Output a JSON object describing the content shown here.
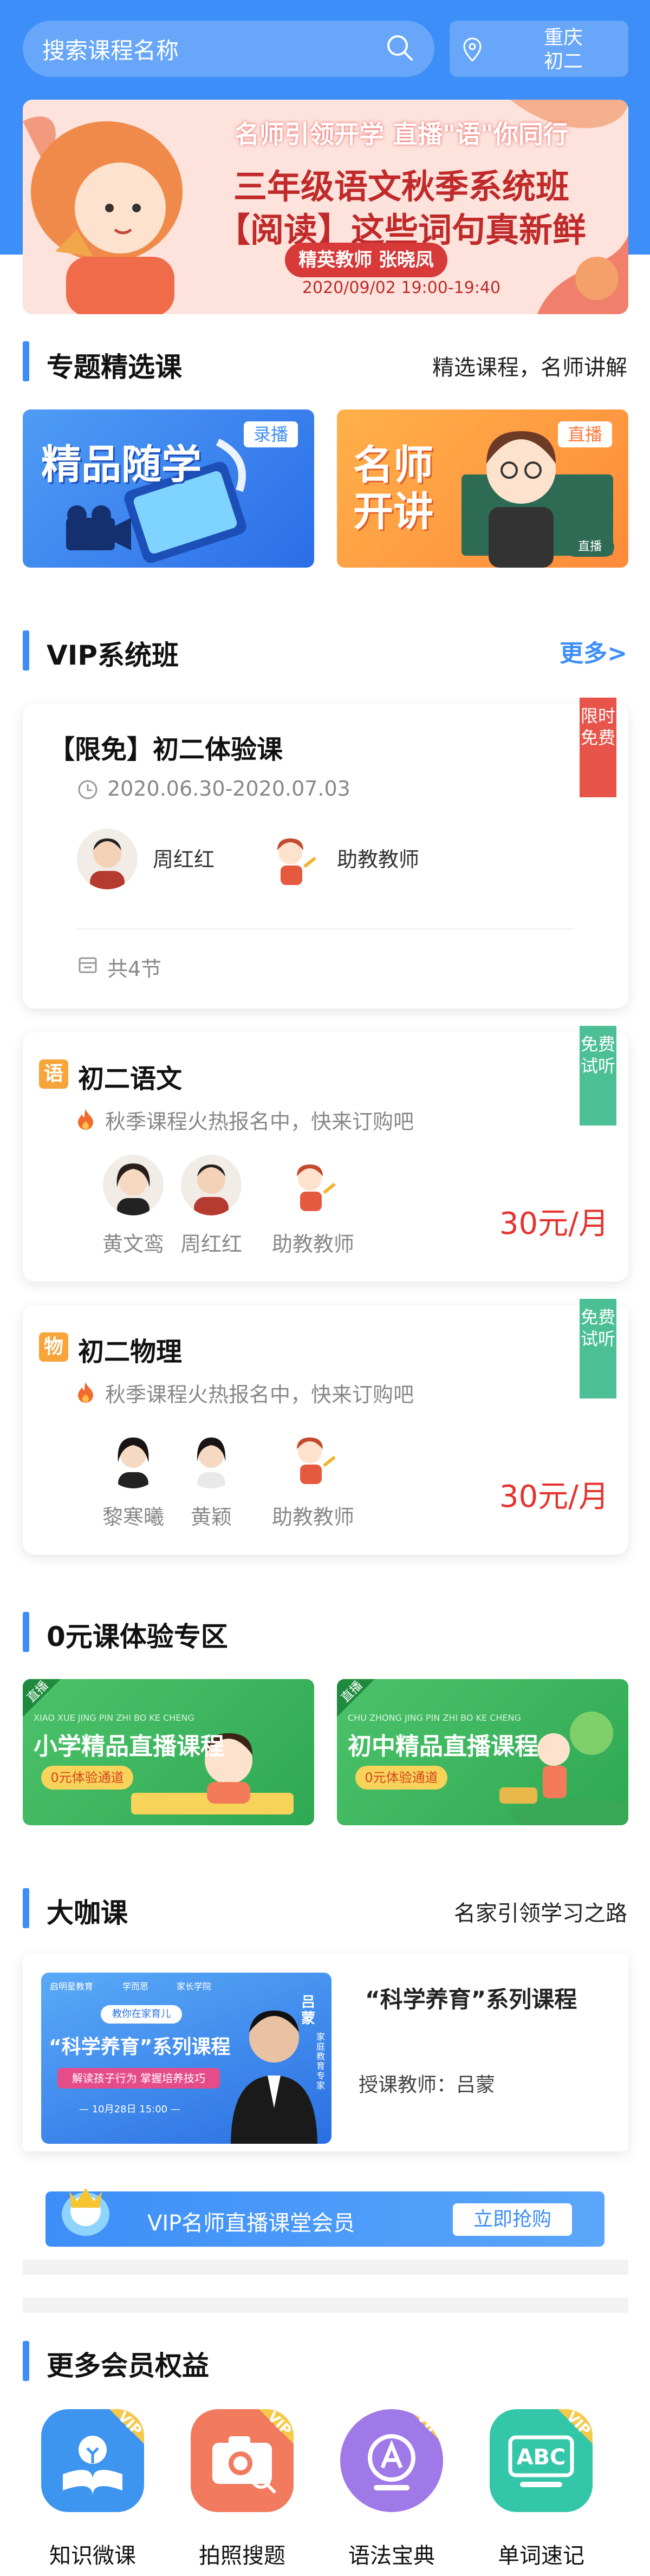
{
  "header": {
    "search_placeholder": "搜索课程名称",
    "location_city": "重庆",
    "location_grade": "初二"
  },
  "banner": {
    "line1": "名师引领开学 直播\"语\"你同行",
    "line2": "三年级语文秋季系统班",
    "line3": "【阅读】这些词句真新鲜",
    "tag": "精英教师 张晓凤",
    "date": "2020/09/02 19:00-19:40"
  },
  "featured": {
    "title": "专题精选课",
    "subtitle": "精选课程，名师讲解",
    "cards": [
      {
        "title": "精品随学",
        "badge": "录播"
      },
      {
        "title": "名师开讲",
        "badge": "直播",
        "mini_tag": "直播"
      }
    ]
  },
  "vip": {
    "title": "VIP系统班",
    "more": "更多>",
    "trial_course": {
      "ribbon": "限时免费",
      "title": "【限免】初二体验课",
      "date": "2020.06.30-2020.07.03",
      "teachers": [
        "周红红",
        "助教教师"
      ],
      "lessons": "共4节"
    },
    "courses": [
      {
        "subject_badge": "语",
        "title": "初二语文",
        "ribbon": "免费试听",
        "desc": "秋季课程火热报名中，快来订购吧",
        "teachers": [
          "黄文鸾",
          "周红红",
          "助教教师"
        ],
        "price": "30元/月"
      },
      {
        "subject_badge": "物",
        "title": "初二物理",
        "ribbon": "免费试听",
        "desc": "秋季课程火热报名中，快来订购吧",
        "teachers": [
          "黎寒曦",
          "黄颖",
          "助教教师"
        ],
        "price": "30元/月"
      }
    ]
  },
  "zero": {
    "title": "0元课体验专区",
    "cards": [
      {
        "corner": "直播",
        "pinyin": "XIAO XUE JING PIN ZHI BO KE CHENG",
        "title": "小学精品直播课程",
        "button": "0元体验通道"
      },
      {
        "corner": "直播",
        "pinyin": "CHU ZHONG JING PIN ZHI BO KE CHENG",
        "title": "初中精品直播课程",
        "button": "0元体验通道"
      }
    ]
  },
  "master": {
    "title": "大咖课",
    "subtitle": "名家引领学习之路",
    "course_title": "“科学养育”系列课程",
    "teacher_line": "授课教师：吕蒙",
    "poster": {
      "brand1": "启明星教育",
      "brand2": "学而思",
      "brand3": "家长学院",
      "top": "教你在家育儿",
      "main": "“科学养育”系列课程",
      "sub": "解读孩子行为 掌握培养技巧",
      "date": "— 10月28日 15:00 —",
      "name": "吕蒙",
      "role": "家庭教育专家"
    }
  },
  "vip_bar": {
    "text": "VIP名师直播课堂会员",
    "button": "立即抢购"
  },
  "benefits": {
    "title": "更多会员权益",
    "items": [
      {
        "label": "知识微课",
        "icon": "lightbulb-book-icon",
        "color": "#3d95f0"
      },
      {
        "label": "拍照搜题",
        "icon": "camera-search-icon",
        "color": "#f27a5e"
      },
      {
        "label": "语法宝典",
        "icon": "letter-a-icon",
        "color": "#a079e8"
      },
      {
        "label": "单词速记",
        "icon": "abc-icon",
        "color": "#33c6a8"
      }
    ],
    "vip_badge": "VIP"
  },
  "colors": {
    "primary": "#3d8ef8",
    "price": "#e5342f",
    "free_ribbon": "#e8534a",
    "trial_ribbon": "#4cbf95",
    "subject_badge": "#f7a43a"
  }
}
